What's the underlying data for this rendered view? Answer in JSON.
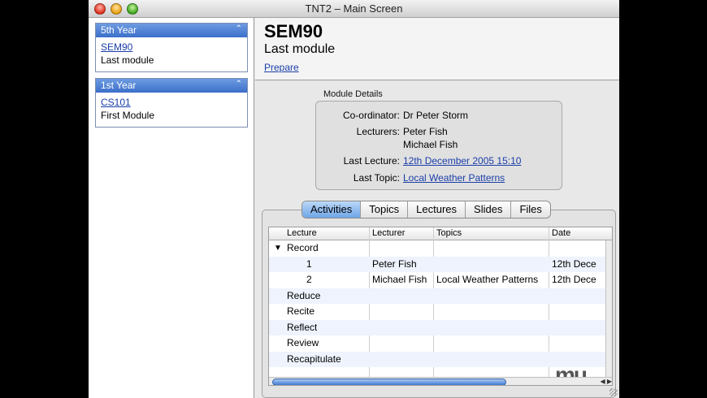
{
  "window": {
    "title": "TNT2 – Main Screen"
  },
  "sidebar": {
    "cards": [
      {
        "header": "5th Year",
        "code": "SEM90",
        "name": "Last module"
      },
      {
        "header": "1st Year",
        "code": "CS101",
        "name": "First Module"
      }
    ]
  },
  "module": {
    "code": "SEM90",
    "name": "Last module",
    "prepare_label": "Prepare"
  },
  "details": {
    "section_label": "Module Details",
    "coordinator_label": "Co-ordinator:",
    "coordinator": "Dr Peter Storm",
    "lecturers_label": "Lecturers:",
    "lecturers": [
      "Peter Fish",
      "Michael Fish"
    ],
    "last_lecture_label": "Last Lecture:",
    "last_lecture": "12th December 2005 15:10",
    "last_topic_label": "Last Topic:",
    "last_topic": "Local Weather Patterns"
  },
  "tabs": [
    "Activities",
    "Topics",
    "Lectures",
    "Slides",
    "Files"
  ],
  "active_tab": "Activities",
  "table": {
    "columns": [
      "Lecture",
      "Lecturer",
      "Topics",
      "Date"
    ],
    "rows": [
      {
        "lecture": "Record",
        "lecturer": "",
        "topics": "",
        "date": "",
        "expanded": true
      },
      {
        "lecture": "1",
        "lecturer": "Peter Fish",
        "topics": "",
        "date": "12th Dece"
      },
      {
        "lecture": "2",
        "lecturer": "Michael Fish",
        "topics": "Local Weather Patterns",
        "date": "12th Dece"
      },
      {
        "lecture": "Reduce",
        "lecturer": "",
        "topics": "",
        "date": ""
      },
      {
        "lecture": "Recite",
        "lecturer": "",
        "topics": "",
        "date": ""
      },
      {
        "lecture": "Reflect",
        "lecturer": "",
        "topics": "",
        "date": ""
      },
      {
        "lecture": "Review",
        "lecturer": "",
        "topics": "",
        "date": ""
      },
      {
        "lecture": "Recapitulate",
        "lecturer": "",
        "topics": "",
        "date": ""
      }
    ]
  },
  "watermark": "mu",
  "colors": {
    "accent": "#3b6fc9",
    "link": "#1a3ea8",
    "row_alt": "#eef3fd"
  }
}
